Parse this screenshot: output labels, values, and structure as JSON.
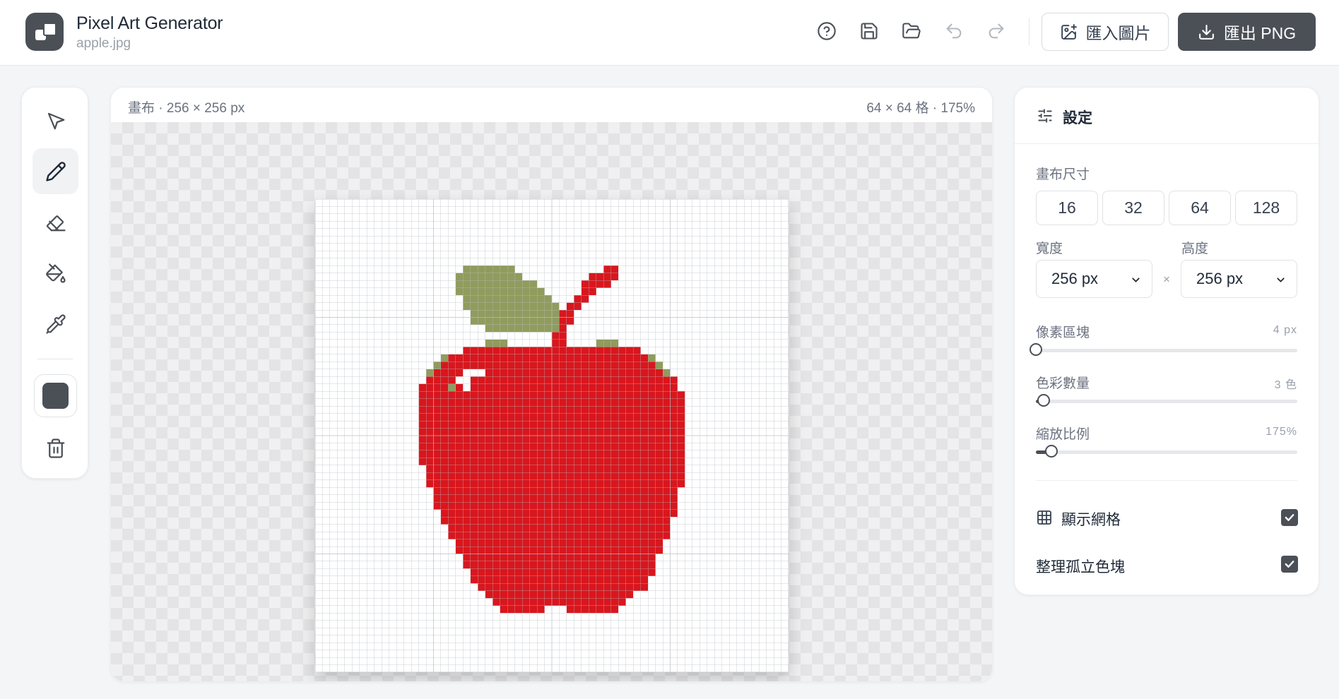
{
  "app": {
    "title": "Pixel Art Generator",
    "file_name": "apple.jpg"
  },
  "header": {
    "import_label": "匯入圖片",
    "export_label": "匯出 PNG",
    "icons": [
      "help-icon",
      "save-icon",
      "folder-open-icon",
      "undo-icon",
      "redo-icon"
    ]
  },
  "toolbar": {
    "tools": [
      "select-tool",
      "pencil-tool",
      "eraser-tool",
      "fill-tool",
      "eyedropper-tool"
    ],
    "active_tool": "pencil-tool",
    "current_color": "#4b5057"
  },
  "canvas": {
    "left_label": "畫布 · 256 × 256 px",
    "right_label": "64 × 64 格 · 175%",
    "grid_cells": 64,
    "colors": {
      "red": "#d9161d",
      "leaf": "#909c5d",
      "highlight": "#ffffff"
    }
  },
  "settings": {
    "title": "設定",
    "canvas_size_label": "畫布尺寸",
    "size_options": [
      "16",
      "32",
      "64",
      "128"
    ],
    "width_label": "寬度",
    "height_label": "高度",
    "width_value": "256 px",
    "height_value": "256 px",
    "separator": "×",
    "pixel_block": {
      "label": "像素區塊",
      "value": "4 px",
      "level": 0.0
    },
    "color_count": {
      "label": "色彩數量",
      "value": "3 色",
      "level": 0.03
    },
    "zoom": {
      "label": "縮放比例",
      "value": "175%",
      "level": 0.06
    },
    "show_grid": {
      "label": "顯示網格",
      "checked": true
    },
    "cleanup": {
      "label": "整理孤立色塊",
      "checked": true
    }
  }
}
